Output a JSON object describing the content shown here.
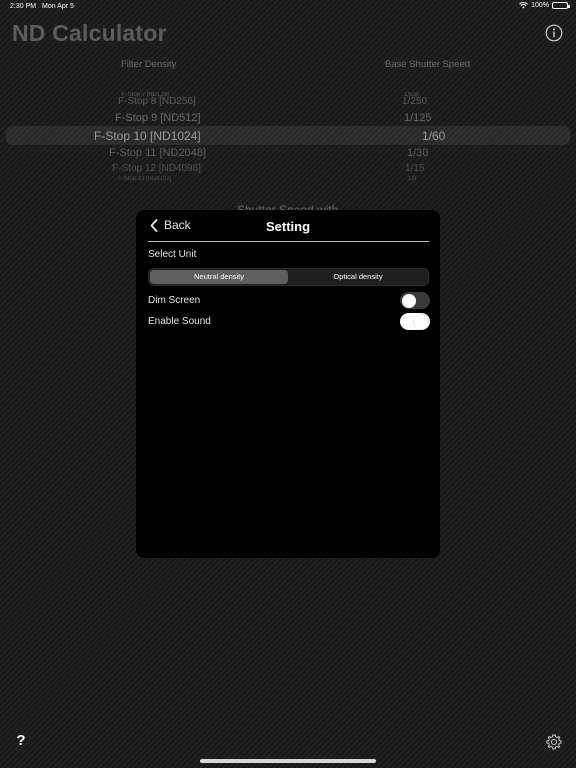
{
  "status": {
    "time": "2:30 PM",
    "date": "Mon Apr 5",
    "battery": "100%"
  },
  "app": {
    "title": "ND Calculator"
  },
  "columns": {
    "left": "Filter Density",
    "right": "Base Shutter Speed"
  },
  "picker": {
    "rows": [
      {
        "label": "F-Stop 7 [ND128]",
        "value": "1/500"
      },
      {
        "label": "F-Stop 8 [ND256]",
        "value": "1/250"
      },
      {
        "label": "F-Stop 9 [ND512]",
        "value": "1/125"
      },
      {
        "label": "F-Stop 10 [ND1024]",
        "value": "1/60"
      },
      {
        "label": "F-Stop 11 [ND2048]",
        "value": "1/30"
      },
      {
        "label": "F-Stop 12 [ND4096]",
        "value": "1/15"
      },
      {
        "label": "F-Stop 13 [ND8192]",
        "value": "1/8"
      }
    ]
  },
  "shutter_label": "Shutter Speed with",
  "settings": {
    "back_label": "Back",
    "title": "Setting",
    "select_unit_label": "Select Unit",
    "unit_options": [
      "Neutral density",
      "Optical density"
    ],
    "selected_unit": "Neutral density",
    "dim_screen_label": "Dim Screen",
    "dim_screen_on": false,
    "enable_sound_label": "Enable Sound",
    "enable_sound_on": true
  },
  "icons": {
    "info": "info-icon",
    "help": "question-mark-icon",
    "settings": "gear-icon",
    "back": "chevron-left-icon"
  }
}
